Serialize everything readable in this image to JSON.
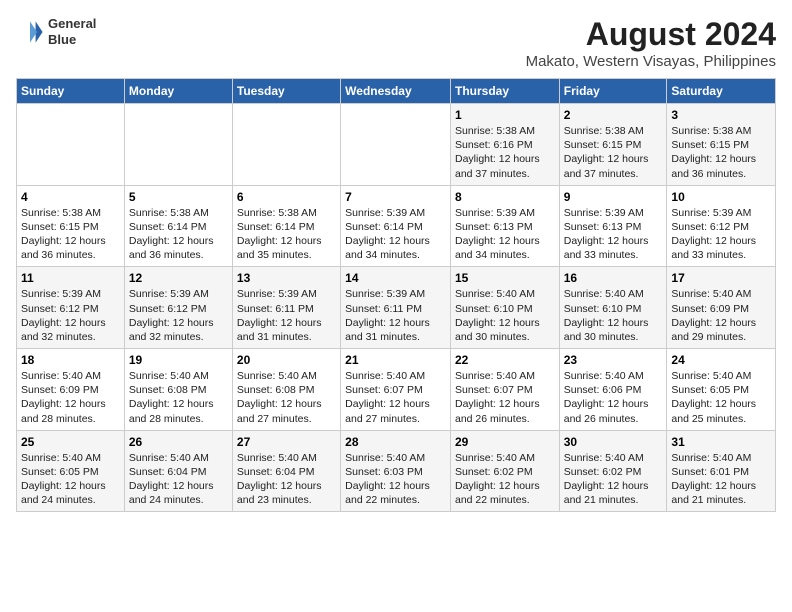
{
  "header": {
    "logo_line1": "General",
    "logo_line2": "Blue",
    "title": "August 2024",
    "subtitle": "Makato, Western Visayas, Philippines"
  },
  "days_of_week": [
    "Sunday",
    "Monday",
    "Tuesday",
    "Wednesday",
    "Thursday",
    "Friday",
    "Saturday"
  ],
  "weeks": [
    [
      {
        "day": "",
        "info": ""
      },
      {
        "day": "",
        "info": ""
      },
      {
        "day": "",
        "info": ""
      },
      {
        "day": "",
        "info": ""
      },
      {
        "day": "1",
        "info": "Sunrise: 5:38 AM\nSunset: 6:16 PM\nDaylight: 12 hours\nand 37 minutes."
      },
      {
        "day": "2",
        "info": "Sunrise: 5:38 AM\nSunset: 6:15 PM\nDaylight: 12 hours\nand 37 minutes."
      },
      {
        "day": "3",
        "info": "Sunrise: 5:38 AM\nSunset: 6:15 PM\nDaylight: 12 hours\nand 36 minutes."
      }
    ],
    [
      {
        "day": "4",
        "info": "Sunrise: 5:38 AM\nSunset: 6:15 PM\nDaylight: 12 hours\nand 36 minutes."
      },
      {
        "day": "5",
        "info": "Sunrise: 5:38 AM\nSunset: 6:14 PM\nDaylight: 12 hours\nand 36 minutes."
      },
      {
        "day": "6",
        "info": "Sunrise: 5:38 AM\nSunset: 6:14 PM\nDaylight: 12 hours\nand 35 minutes."
      },
      {
        "day": "7",
        "info": "Sunrise: 5:39 AM\nSunset: 6:14 PM\nDaylight: 12 hours\nand 34 minutes."
      },
      {
        "day": "8",
        "info": "Sunrise: 5:39 AM\nSunset: 6:13 PM\nDaylight: 12 hours\nand 34 minutes."
      },
      {
        "day": "9",
        "info": "Sunrise: 5:39 AM\nSunset: 6:13 PM\nDaylight: 12 hours\nand 33 minutes."
      },
      {
        "day": "10",
        "info": "Sunrise: 5:39 AM\nSunset: 6:12 PM\nDaylight: 12 hours\nand 33 minutes."
      }
    ],
    [
      {
        "day": "11",
        "info": "Sunrise: 5:39 AM\nSunset: 6:12 PM\nDaylight: 12 hours\nand 32 minutes."
      },
      {
        "day": "12",
        "info": "Sunrise: 5:39 AM\nSunset: 6:12 PM\nDaylight: 12 hours\nand 32 minutes."
      },
      {
        "day": "13",
        "info": "Sunrise: 5:39 AM\nSunset: 6:11 PM\nDaylight: 12 hours\nand 31 minutes."
      },
      {
        "day": "14",
        "info": "Sunrise: 5:39 AM\nSunset: 6:11 PM\nDaylight: 12 hours\nand 31 minutes."
      },
      {
        "day": "15",
        "info": "Sunrise: 5:40 AM\nSunset: 6:10 PM\nDaylight: 12 hours\nand 30 minutes."
      },
      {
        "day": "16",
        "info": "Sunrise: 5:40 AM\nSunset: 6:10 PM\nDaylight: 12 hours\nand 30 minutes."
      },
      {
        "day": "17",
        "info": "Sunrise: 5:40 AM\nSunset: 6:09 PM\nDaylight: 12 hours\nand 29 minutes."
      }
    ],
    [
      {
        "day": "18",
        "info": "Sunrise: 5:40 AM\nSunset: 6:09 PM\nDaylight: 12 hours\nand 28 minutes."
      },
      {
        "day": "19",
        "info": "Sunrise: 5:40 AM\nSunset: 6:08 PM\nDaylight: 12 hours\nand 28 minutes."
      },
      {
        "day": "20",
        "info": "Sunrise: 5:40 AM\nSunset: 6:08 PM\nDaylight: 12 hours\nand 27 minutes."
      },
      {
        "day": "21",
        "info": "Sunrise: 5:40 AM\nSunset: 6:07 PM\nDaylight: 12 hours\nand 27 minutes."
      },
      {
        "day": "22",
        "info": "Sunrise: 5:40 AM\nSunset: 6:07 PM\nDaylight: 12 hours\nand 26 minutes."
      },
      {
        "day": "23",
        "info": "Sunrise: 5:40 AM\nSunset: 6:06 PM\nDaylight: 12 hours\nand 26 minutes."
      },
      {
        "day": "24",
        "info": "Sunrise: 5:40 AM\nSunset: 6:05 PM\nDaylight: 12 hours\nand 25 minutes."
      }
    ],
    [
      {
        "day": "25",
        "info": "Sunrise: 5:40 AM\nSunset: 6:05 PM\nDaylight: 12 hours\nand 24 minutes."
      },
      {
        "day": "26",
        "info": "Sunrise: 5:40 AM\nSunset: 6:04 PM\nDaylight: 12 hours\nand 24 minutes."
      },
      {
        "day": "27",
        "info": "Sunrise: 5:40 AM\nSunset: 6:04 PM\nDaylight: 12 hours\nand 23 minutes."
      },
      {
        "day": "28",
        "info": "Sunrise: 5:40 AM\nSunset: 6:03 PM\nDaylight: 12 hours\nand 22 minutes."
      },
      {
        "day": "29",
        "info": "Sunrise: 5:40 AM\nSunset: 6:02 PM\nDaylight: 12 hours\nand 22 minutes."
      },
      {
        "day": "30",
        "info": "Sunrise: 5:40 AM\nSunset: 6:02 PM\nDaylight: 12 hours\nand 21 minutes."
      },
      {
        "day": "31",
        "info": "Sunrise: 5:40 AM\nSunset: 6:01 PM\nDaylight: 12 hours\nand 21 minutes."
      }
    ]
  ]
}
